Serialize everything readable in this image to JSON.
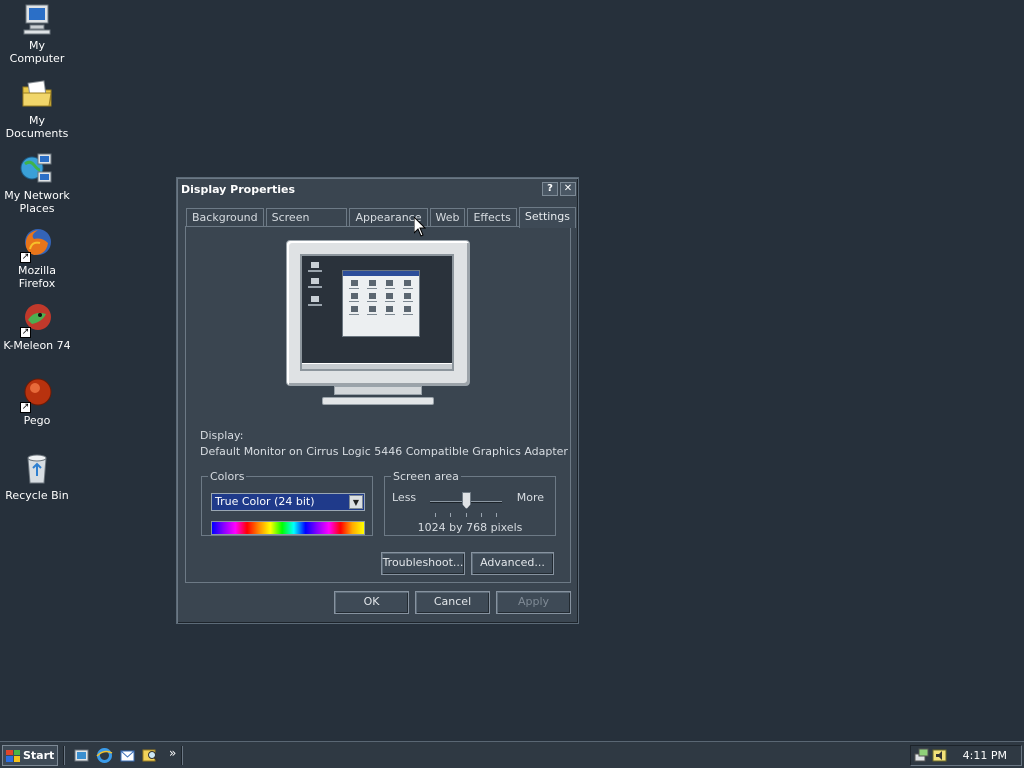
{
  "desktop": {
    "icons": [
      {
        "label": "My Computer"
      },
      {
        "label": "My Documents"
      },
      {
        "label": "My Network Places"
      },
      {
        "label": "Mozilla Firefox"
      },
      {
        "label": "K-Meleon 74"
      },
      {
        "label": "Pego"
      },
      {
        "label": "Recycle Bin"
      }
    ]
  },
  "dialog": {
    "title": "Display Properties",
    "help_button": "?",
    "close_button": "✕",
    "tabs": [
      {
        "label": "Background"
      },
      {
        "label": "Screen Saver"
      },
      {
        "label": "Appearance"
      },
      {
        "label": "Web"
      },
      {
        "label": "Effects"
      },
      {
        "label": "Settings"
      }
    ],
    "active_tab": "Settings",
    "display_label": "Display:",
    "display_value": "Default Monitor on Cirrus Logic 5446 Compatible Graphics Adapter",
    "colors": {
      "legend": "Colors",
      "selected": "True Color (24 bit)"
    },
    "screen_area": {
      "legend": "Screen area",
      "less_label": "Less",
      "more_label": "More",
      "resolution": "1024 by 768 pixels",
      "slider_level": 0.5
    },
    "buttons": {
      "troubleshoot": "Troubleshoot...",
      "advanced": "Advanced...",
      "ok": "OK",
      "cancel": "Cancel",
      "apply": "Apply"
    }
  },
  "taskbar": {
    "start_label": "Start",
    "chevron": "»",
    "clock": "4:11 PM"
  },
  "colors": {
    "desktop_bg": "#26303b",
    "dialog_bg": "#3a4550",
    "select_highlight": "#1f3a8a"
  }
}
